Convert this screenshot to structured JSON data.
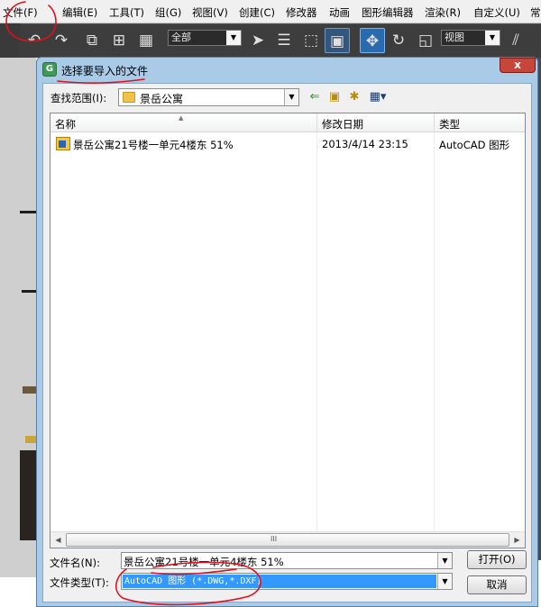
{
  "menubar": {
    "items": [
      "文件(F)",
      "编辑(E)",
      "工具(T)",
      "组(G)",
      "视图(V)",
      "创建(C)",
      "修改器",
      "动画",
      "图形编辑器",
      "渲染(R)",
      "自定义(U)",
      "常"
    ]
  },
  "toolbar": {
    "selection_filter": "全部",
    "reference_coord": "视图"
  },
  "dialog": {
    "title": "选择要导入的文件",
    "close_label": "x",
    "look_in_label": "查找范围(I):",
    "look_in_value": "景岳公寓",
    "columns": [
      "名称",
      "修改日期",
      "类型"
    ],
    "files": [
      {
        "name": "景岳公寓21号楼一单元4楼东 51%",
        "modified": "2013/4/14 23:15",
        "type": "AutoCAD 图形"
      }
    ],
    "scroll_grip": "III",
    "file_name_label": "文件名(N):",
    "file_name_value": "景岳公寓21号楼一单元4楼东 51%",
    "file_type_label": "文件类型(T):",
    "file_type_value": "AutoCAD 图形 (*.DWG,*.DXF)",
    "open_button": "打开(O)",
    "cancel_button": "取消"
  },
  "colors": {
    "dialog_frame": "#a9cbe8",
    "selection": "#3399ff",
    "annotation": "#e0101c",
    "toolbar_bg": "#3d3d3d"
  }
}
